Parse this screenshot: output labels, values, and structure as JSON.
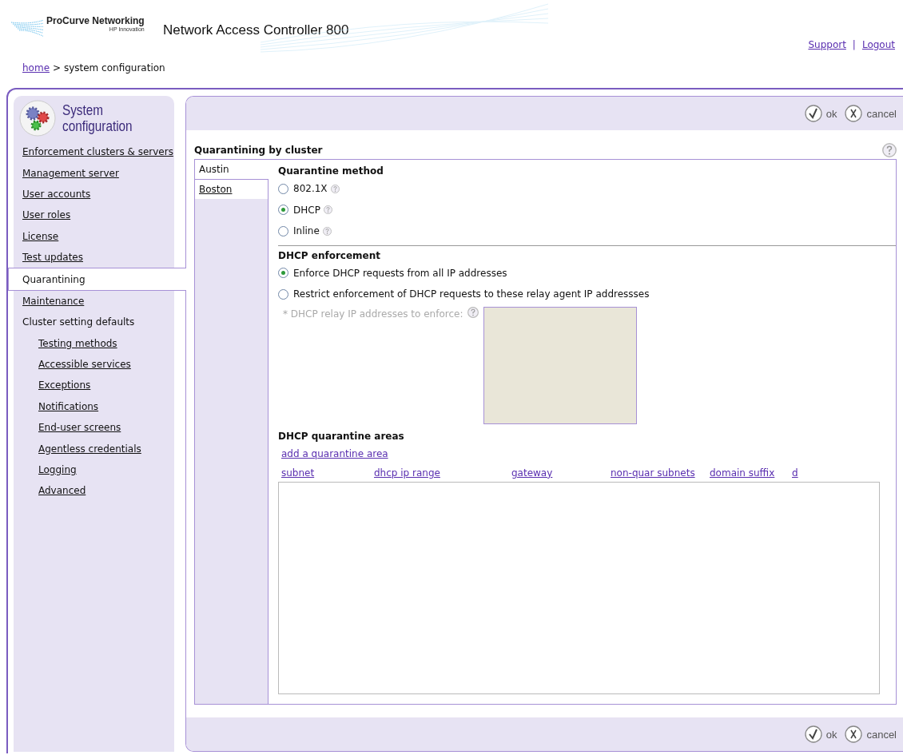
{
  "header": {
    "brand": "ProCurve Networking",
    "tagline": "HP Innovation",
    "title": "Network Access Controller 800",
    "links": [
      "Support",
      "Logout"
    ],
    "separator": "|"
  },
  "breadcrumb": {
    "link": "home",
    "rest": "> system configuration"
  },
  "sidebar": {
    "title": [
      "System",
      "configuration"
    ],
    "items": [
      {
        "label": "Enforcement clusters & servers",
        "kind": "link",
        "selected": false
      },
      {
        "label": "Management server",
        "kind": "link",
        "selected": false
      },
      {
        "label": "User accounts",
        "kind": "link",
        "selected": false
      },
      {
        "label": "User roles",
        "kind": "link",
        "selected": false
      },
      {
        "label": "License",
        "kind": "link",
        "selected": false
      },
      {
        "label": "Test updates",
        "kind": "link",
        "selected": false
      },
      {
        "label": "Quarantining",
        "kind": "link",
        "selected": true
      },
      {
        "label": "Maintenance",
        "kind": "link",
        "selected": false
      },
      {
        "label": "Cluster setting defaults",
        "kind": "group",
        "selected": false,
        "children": [
          {
            "label": "Testing methods",
            "kind": "link",
            "selected": false
          },
          {
            "label": "Accessible services",
            "kind": "link",
            "selected": false
          },
          {
            "label": "Exceptions",
            "kind": "link",
            "selected": false
          },
          {
            "label": "Notifications",
            "kind": "link",
            "selected": false
          },
          {
            "label": "End-user screens",
            "kind": "link",
            "selected": false
          },
          {
            "label": "Agentless credentials",
            "kind": "link",
            "selected": false
          },
          {
            "label": "Logging",
            "kind": "link",
            "selected": false
          },
          {
            "label": "Advanced",
            "kind": "link",
            "selected": false
          }
        ]
      }
    ]
  },
  "top_actions": {
    "ok": "ok",
    "cancel": "cancel"
  },
  "bottom_actions": {
    "ok": "ok",
    "cancel": "cancel"
  },
  "content": {
    "title": "Quarantining by cluster",
    "clusters": [
      {
        "label": "Austin",
        "selected": true
      },
      {
        "label": "Boston",
        "selected": false
      }
    ],
    "method": {
      "title": "Quarantine method",
      "options": [
        {
          "label": "802.1X",
          "selected": false
        },
        {
          "label": "DHCP",
          "selected": true
        },
        {
          "label": "Inline",
          "selected": false
        }
      ]
    },
    "enforcement": {
      "title": "DHCP enforcement",
      "options": [
        {
          "label": "Enforce DHCP requests from all IP addresses",
          "selected": true
        },
        {
          "label": "Restrict enforcement of DHCP requests to these relay agent IP addressses",
          "selected": false
        }
      ],
      "relay": {
        "label": "* DHCP relay IP addresses to enforce:",
        "disabled": true
      }
    },
    "areas": {
      "title": "DHCP quarantine areas",
      "add_link": "add a quarantine area",
      "columns": [
        "subnet",
        "dhcp ip range",
        "gateway",
        "non-quar subnets",
        "domain suffix",
        "d"
      ]
    }
  }
}
